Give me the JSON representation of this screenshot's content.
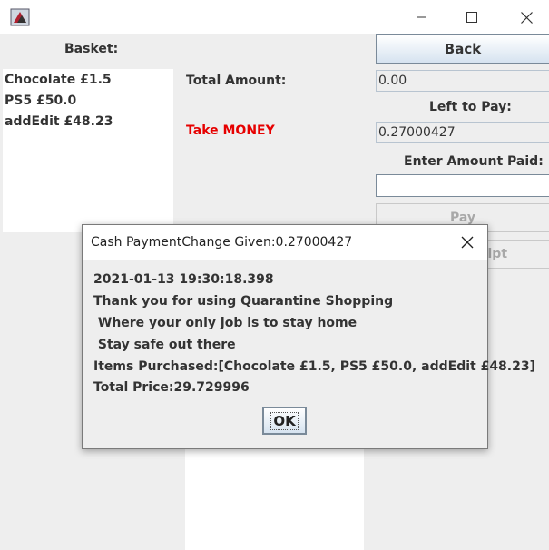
{
  "window": {
    "minimize_glyph": "—",
    "maximize_glyph": "☐",
    "close_glyph": "✕"
  },
  "basket": {
    "label": "Basket:",
    "items": [
      "Chocolate £1.5",
      "PS5 £50.0",
      "addEdit £48.23"
    ]
  },
  "total": {
    "label": "Total Amount:",
    "value": "0.00"
  },
  "left_to_pay": {
    "label": "Left to Pay:",
    "value": "0.27000427"
  },
  "take_money": {
    "text": "Take MONEY",
    "color": "#e60000"
  },
  "enter_amount": {
    "label": "Enter Amount Paid:",
    "value": ""
  },
  "buttons": {
    "back": "Back",
    "pay": "Pay",
    "receipt_partial": "eipt"
  },
  "dialog": {
    "title": "Cash PaymentChange Given:0.27000427",
    "lines": [
      "2021-01-13 19:30:18.398",
      "Thank you for using Quarantine Shopping",
      " Where your only job is to stay home",
      " Stay safe out there",
      "Items Purchased:[Chocolate £1.5, PS5 £50.0, addEdit £48.23]",
      "Total Price:29.729996"
    ],
    "ok_label": "OK"
  }
}
